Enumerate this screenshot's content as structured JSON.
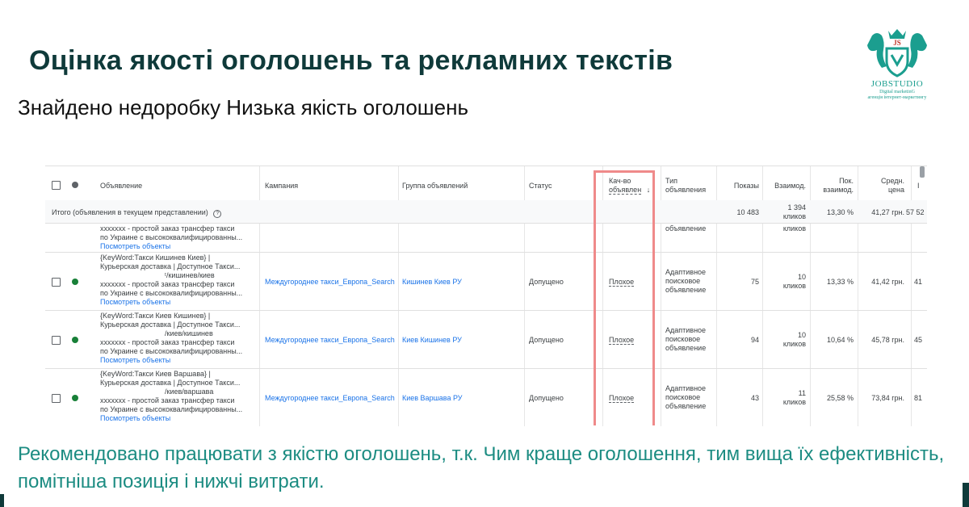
{
  "slide": {
    "title": "Оцінка якості оголошень та рекламних текстів",
    "subtitle": "Знайдено недоробку Низька якість оголошень",
    "recommendation": "Рекомендовано працювати з якістю оголошень, т.к. Чим краще оголошення, тим вища їх ефективність, помітніша позиція і нижчі витрати."
  },
  "logo": {
    "name": "JOBSTUDIO",
    "tagline1": "Digital marketinG",
    "tagline2": "агенція інтернет-маркетингу",
    "icon": "horses-crest-icon"
  },
  "table": {
    "headers": {
      "ad": "Объявление",
      "campaign": "Кампания",
      "adgroup": "Группа объявлений",
      "status": "Статус",
      "quality_1": "Кач-во",
      "quality_2": "объявлен",
      "type_1": "Тип",
      "type_2": "объявления",
      "impressions": "Показы",
      "interactions": "Взаимод.",
      "rate_1": "Пок.",
      "rate_2": "взаимод.",
      "avg_1": "Средн.",
      "avg_2": "цена",
      "extra": "I"
    },
    "total": {
      "label": "Итого (объявления в текущем представлении)",
      "impressions": "10 483",
      "interactions_1": "1 394",
      "interactions_2": "кликов",
      "rate": "13,30 %",
      "avg": "41,27 грн.",
      "extra": "57 52"
    },
    "partial": {
      "ad_1": "ххххххх - простой заказ трансфер такси",
      "ad_2": "по Украине с высококвалифицированны...",
      "ad_3": "Посмотреть объекты",
      "type": "объявление",
      "interactions": "кликов"
    },
    "rows": [
      {
        "ad_1": "{KeyWord:Такси Кишинев Киев} |",
        "ad_2": "Курьерская доставка | Доступное Такси...",
        "ad_3": "ᵗ/кишинев/киев",
        "ad_4": "ххххххх - простой заказ трансфер такси",
        "ad_5": "по Украине с высококвалифицированны...",
        "ad_6": "Посмотреть объекты",
        "campaign": "Междугороднее такси_Европа_Search",
        "adgroup": "Кишинев Киев РУ",
        "status": "Допущено",
        "quality": "Плохое",
        "type_1": "Адаптивное",
        "type_2": "поисковое",
        "type_3": "объявление",
        "impressions": "75",
        "interactions_1": "10",
        "interactions_2": "кликов",
        "rate": "13,33 %",
        "avg": "41,42 грн.",
        "extra": "41"
      },
      {
        "ad_1": "{KeyWord:Такси Киев Кишинев} |",
        "ad_2": "Курьерская доставка | Доступное Такси...",
        "ad_3": "/киев/кишинев",
        "ad_4": "ххххххх - простой заказ трансфер такси",
        "ad_5": "по Украине с высококвалифицированны...",
        "ad_6": "Посмотреть объекты",
        "campaign": "Междугороднее такси_Европа_Search",
        "adgroup": "Киев Кишинев РУ",
        "status": "Допущено",
        "quality": "Плохое",
        "type_1": "Адаптивное",
        "type_2": "поисковое",
        "type_3": "объявление",
        "impressions": "94",
        "interactions_1": "10",
        "interactions_2": "кликов",
        "rate": "10,64 %",
        "avg": "45,78 грн.",
        "extra": "45"
      },
      {
        "ad_1": "{KeyWord:Такси Киев Варшава} |",
        "ad_2": "Курьерская доставка | Доступное Такси...",
        "ad_3": "/киев/варшава",
        "ad_4": "ххххххх - простой заказ трансфер такси",
        "ad_5": "по Украине с высококвалифицированны...",
        "ad_6": "Посмотреть объекты",
        "campaign": "Междугороднее такси_Европа_Search",
        "adgroup": "Киев Варшава РУ",
        "status": "Допущено",
        "quality": "Плохое",
        "type_1": "Адаптивное",
        "type_2": "поисковое",
        "type_3": "объявление",
        "impressions": "43",
        "interactions_1": "11",
        "interactions_2": "кликов",
        "rate": "25,58 %",
        "avg": "73,84 грн.",
        "extra": "81"
      }
    ],
    "colors": {
      "active_dot": "#188038",
      "header_dot": "#5f6368",
      "highlight": "#ef8a8a"
    }
  }
}
